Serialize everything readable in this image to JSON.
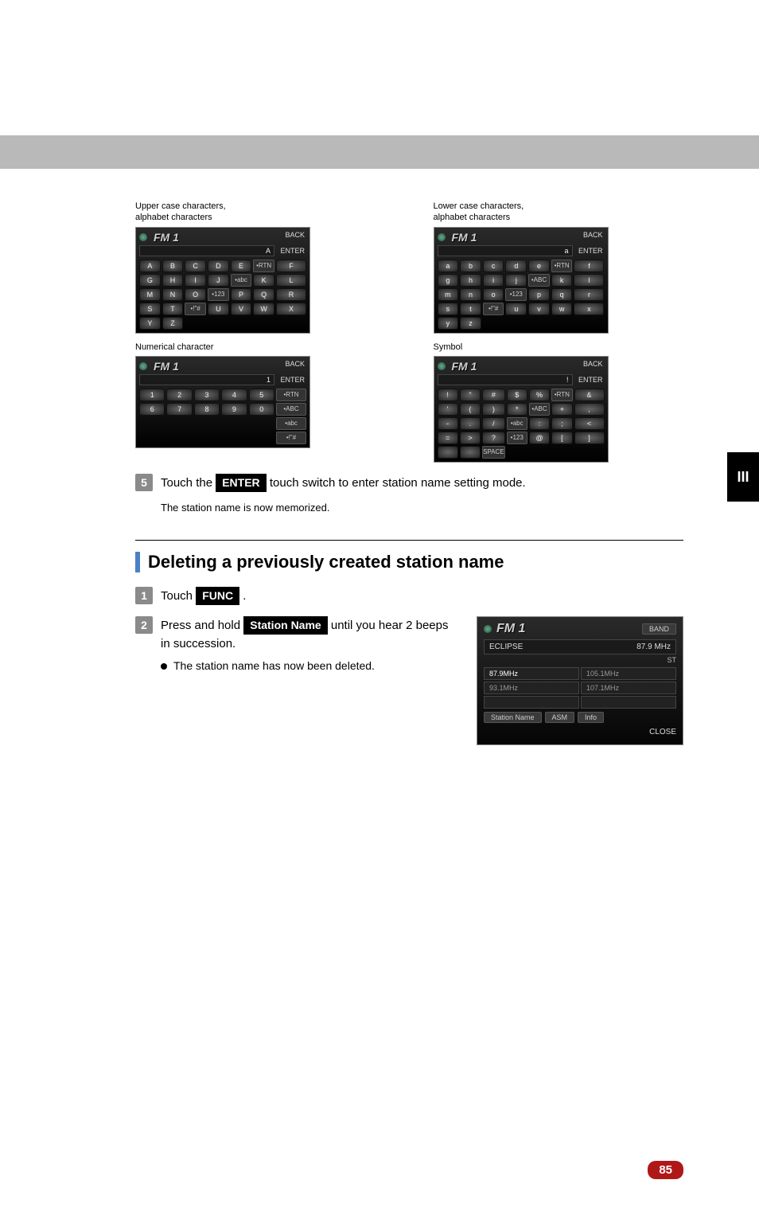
{
  "side_tab": "III",
  "page_number": "85",
  "keyboards": {
    "upper": {
      "caption": "Upper case characters,\nalphabet characters",
      "title": "FM 1",
      "back": "BACK",
      "enter": "ENTER",
      "preview": "A",
      "rows": [
        [
          "A",
          "B",
          "C",
          "D",
          "E",
          "•RTN"
        ],
        [
          "F",
          "G",
          "H",
          "I",
          "J",
          "•abc"
        ],
        [
          "K",
          "L",
          "M",
          "N",
          "O",
          "•123"
        ],
        [
          "P",
          "Q",
          "R",
          "S",
          "T",
          "•!\"#"
        ],
        [
          "U",
          "V",
          "W",
          "X",
          "Y",
          "Z"
        ]
      ]
    },
    "lower": {
      "caption": "Lower case characters,\nalphabet characters",
      "title": "FM 1",
      "back": "BACK",
      "enter": "ENTER",
      "preview": "a",
      "rows": [
        [
          "a",
          "b",
          "c",
          "d",
          "e",
          "•RTN"
        ],
        [
          "f",
          "g",
          "h",
          "i",
          "j",
          "•ABC"
        ],
        [
          "k",
          "l",
          "m",
          "n",
          "o",
          "•123"
        ],
        [
          "p",
          "q",
          "r",
          "s",
          "t",
          "•!\"#"
        ],
        [
          "u",
          "v",
          "w",
          "x",
          "y",
          "z"
        ]
      ]
    },
    "numeric": {
      "caption": "Numerical character",
      "title": "FM 1",
      "back": "BACK",
      "enter": "ENTER",
      "preview": "1",
      "rows": [
        [
          "1",
          "2",
          "3",
          "4",
          "5",
          "•RTN"
        ],
        [
          "6",
          "7",
          "8",
          "9",
          "0",
          "•ABC"
        ],
        [
          "",
          "",
          "",
          "",
          "",
          "•abc"
        ],
        [
          "",
          "",
          "",
          "",
          "",
          "•!\"#"
        ]
      ]
    },
    "symbol": {
      "caption": "Symbol",
      "title": "FM 1",
      "back": "BACK",
      "enter": "ENTER",
      "preview": "!",
      "rows": [
        [
          "!",
          "\"",
          "#",
          "$",
          "%",
          "•RTN"
        ],
        [
          "&",
          "'",
          "(",
          ")",
          "*",
          "•ABC"
        ],
        [
          "+",
          ",",
          "-",
          ".",
          "/",
          "•abc"
        ],
        [
          ":",
          ";",
          "<",
          "=",
          ">",
          "?",
          "•123"
        ],
        [
          "@",
          "[",
          "]",
          " ",
          " ",
          "SPACE"
        ]
      ]
    }
  },
  "step5": {
    "num": "5",
    "pre": "Touch the ",
    "chip": "ENTER",
    "post": " touch switch to enter station name setting mode.",
    "sub": "The station name is now memorized."
  },
  "section": {
    "heading": "Deleting a previously created station name"
  },
  "del_step1": {
    "num": "1",
    "pre": "Touch ",
    "chip": "FUNC",
    "post": " ."
  },
  "del_step2": {
    "num": "2",
    "pre": "Press and hold ",
    "chip": "Station Name",
    "post": " until you hear 2 beeps in succession.",
    "bullet": "The station name has now been deleted."
  },
  "radio": {
    "band_title": "FM 1",
    "band_btn": "BAND",
    "station_label": "ECLIPSE",
    "freq_main": "87.9 MHz",
    "stereo": "ST",
    "presets": [
      {
        "label": "87.9MHz",
        "active": true
      },
      {
        "label": "105.1MHz",
        "active": false
      },
      {
        "label": "93.1MHz",
        "active": false
      },
      {
        "label": "107.1MHz",
        "active": false
      },
      {
        "label": "",
        "active": false
      },
      {
        "label": "",
        "active": false
      }
    ],
    "station_name_btn": "Station Name",
    "asm_btn": "ASM",
    "info_btn": "Info",
    "close": "CLOSE"
  }
}
